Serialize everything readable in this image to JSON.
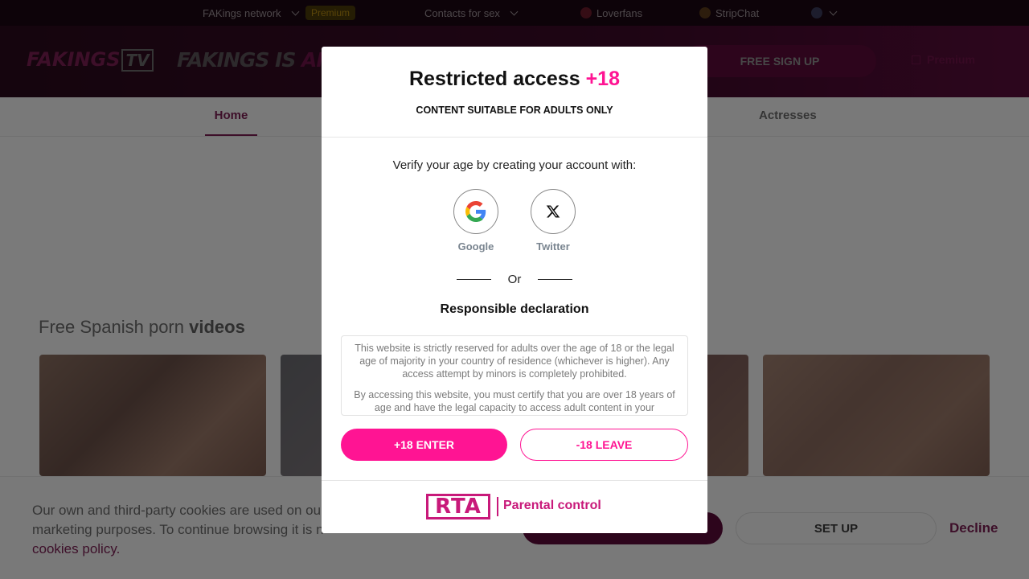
{
  "topbar": {
    "network": "FAKings network",
    "premium_badge": "Premium",
    "contacts": "Contacts for sex",
    "loverfans": "Loverfans",
    "stripchat": "StripChat"
  },
  "header": {
    "logo": "FAKINGS",
    "logo_tv": "TV",
    "slogan_a": "FAKINGS IS ",
    "slogan_b": "AMATE",
    "signup": "FREE SIGN UP",
    "premium": "Premium"
  },
  "nav": {
    "home": "Home",
    "actresses": "Actresses"
  },
  "section": {
    "title_a": "Free Spanish porn ",
    "title_b": "videos"
  },
  "cookie": {
    "line1": "Our own and third-party cookies are used on our",
    "line2": "marketing purposes. To continue browsing it is n",
    "link": "cookies policy.",
    "setup": "SET UP",
    "decline": "Decline"
  },
  "modal": {
    "title": "Restricted access ",
    "title_age": "+18",
    "subtitle": "CONTENT SUITABLE FOR ADULTS ONLY",
    "verify": "Verify your age by creating your account with:",
    "google": "Google",
    "twitter": "Twitter",
    "or": "Or",
    "declaration_title": "Responsible declaration",
    "declaration_p1": "This website is strictly reserved for adults over the age of 18 or the legal age of majority in your country of residence (whichever is higher). Any access attempt by minors is completely prohibited.",
    "declaration_p2": "By accessing this website, you must certify that you are over 18 years of age and have the legal capacity to access adult content in your",
    "enter": "+18 ENTER",
    "leave": "-18 LEAVE",
    "rta": "RTA",
    "parental": "Parental control"
  },
  "colors": {
    "accent": "#ff1493",
    "rta": "#c8197a"
  }
}
